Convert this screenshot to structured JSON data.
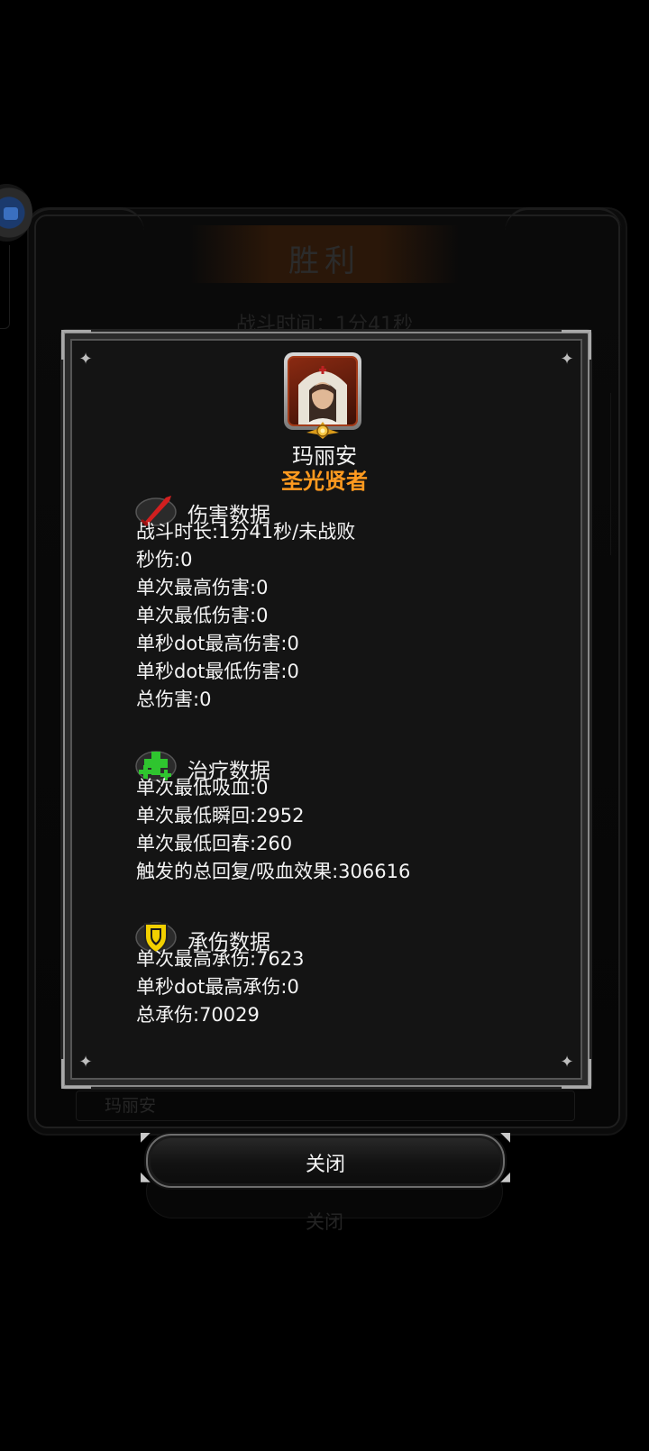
{
  "background": {
    "result_title": "胜利",
    "battle_time": "战斗时间：1分41秒",
    "hero_row_name": "玛丽安",
    "close_label": "关闭"
  },
  "hero": {
    "name": "玛丽安",
    "title": "圣光贤者"
  },
  "sections": {
    "damage": {
      "title": "伤害数据",
      "icon": "red-sword-icon",
      "lines": [
        "战斗时长:1分41秒/未战败",
        "秒伤:0",
        "单次最高伤害:0",
        "单次最低伤害:0",
        "单秒dot最高伤害:0",
        "单秒dot最低伤害:0",
        "总伤害:0"
      ]
    },
    "heal": {
      "title": "治疗数据",
      "icon": "green-cross-icon",
      "lines": [
        "单次最低吸血:0",
        "单次最低瞬回:2952",
        "单次最低回春:260",
        "触发的总回复/吸血效果:306616"
      ]
    },
    "tank": {
      "title": "承伤数据",
      "icon": "yellow-shield-icon",
      "lines": [
        "单次最高承伤:7623",
        "单秒dot最高承伤:0",
        "总承伤:70029"
      ]
    }
  },
  "close_button": {
    "label": "关闭"
  },
  "colors": {
    "hero_title": "#ff9a1f",
    "damage_icon": "#d21f1f",
    "heal_icon": "#2fc52f",
    "tank_icon": "#f2d000"
  }
}
